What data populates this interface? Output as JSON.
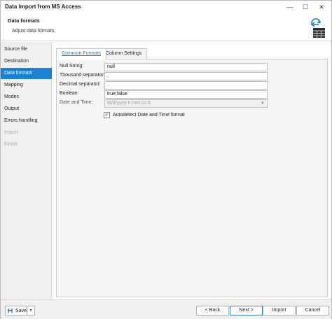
{
  "window": {
    "title": "Data Import from MS Access",
    "controls": {
      "minimize": "—",
      "maximize": "☐",
      "close": "✕"
    }
  },
  "header": {
    "title": "Data formats",
    "subtitle": "Adjust data formats.",
    "icon": "import-table-icon"
  },
  "sidebar": {
    "items": [
      {
        "label": "Source file",
        "state": "normal"
      },
      {
        "label": "Destination",
        "state": "normal"
      },
      {
        "label": "Data formats",
        "state": "active"
      },
      {
        "label": "Mapping",
        "state": "normal"
      },
      {
        "label": "Modes",
        "state": "normal"
      },
      {
        "label": "Output",
        "state": "normal"
      },
      {
        "label": "Errors handling",
        "state": "normal"
      },
      {
        "label": "Import",
        "state": "disabled"
      },
      {
        "label": "Finish",
        "state": "disabled"
      }
    ]
  },
  "tabs": [
    {
      "label": "Common Formats",
      "active": true
    },
    {
      "label": "Column Settings",
      "active": false
    }
  ],
  "form": {
    "null_string": {
      "label": "Null String:",
      "value": "null"
    },
    "thousand_separator": {
      "label": "Thousand separator:",
      "value": ","
    },
    "decimal_separator": {
      "label": "Decimal separator:",
      "value": "."
    },
    "boolean": {
      "label": "Boolean:",
      "value": "true;false"
    },
    "date_time": {
      "label": "Date and Time:",
      "value": "M/d/yyyy h:mm:ss tt"
    },
    "autodetect": {
      "label": "Autodetect Date and Time format",
      "checked": true,
      "mark": "✓"
    }
  },
  "footer": {
    "save_label": "Save",
    "save_dropdown": "▾",
    "back_label": "< Back",
    "next_label": "Next >",
    "import_label": "Import",
    "cancel_label": "Cancel"
  },
  "colors": {
    "accent": "#1e80d0",
    "sidebar_bg": "#f0f0f0",
    "panel_bg": "#f5f5f5"
  }
}
